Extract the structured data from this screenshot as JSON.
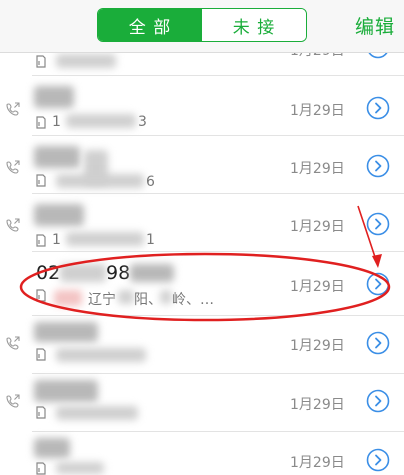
{
  "header": {
    "tabs": [
      {
        "label": "全 部",
        "active": true
      },
      {
        "label": "未 接",
        "active": false
      }
    ],
    "edit_label": "编辑"
  },
  "colors": {
    "accent": "#1aad3a",
    "detail_icon": "#3a8ee6",
    "annotation": "#e02020"
  },
  "calls": [
    {
      "name": "",
      "sub": "",
      "date": "1月29日"
    },
    {
      "name": "",
      "sub": "1",
      "sub_tail": "3",
      "date": "1月29日"
    },
    {
      "name": "",
      "sub": "",
      "sub_tail": "6",
      "date": "1月29日"
    },
    {
      "name": "",
      "sub": "1",
      "sub_tail": "1",
      "date": "1月29日"
    },
    {
      "name_a": "02",
      "name_b": "98",
      "sub": "辽宁",
      "sub_b": "阳、",
      "sub_c": "岭、…",
      "date": "1月29日"
    },
    {
      "name": "",
      "sub": "",
      "date": "1月29日"
    },
    {
      "name": "",
      "sub": "",
      "date": "1月29日"
    },
    {
      "name": "",
      "sub": "",
      "date": "1月29日"
    }
  ]
}
